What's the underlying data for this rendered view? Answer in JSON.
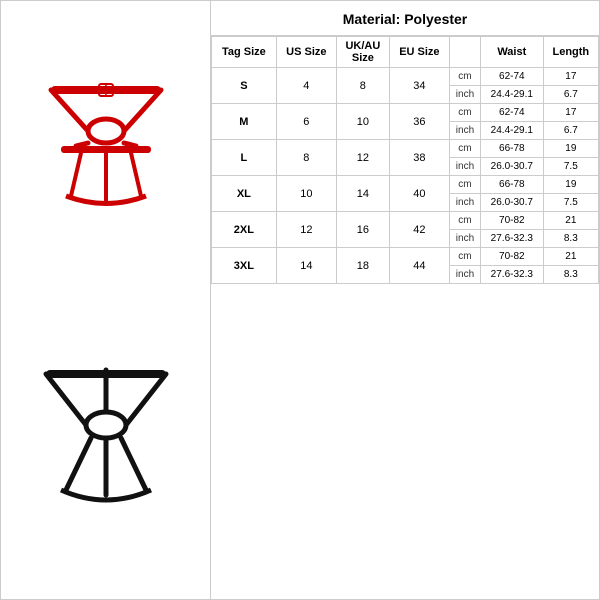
{
  "material": "Material: Polyester",
  "columns": {
    "tag_size": "Tag Size",
    "us_size": "US Size",
    "ukau_size": "UK/AU Size",
    "eu_size": "EU Size",
    "unit": "",
    "waist": "Waist",
    "length": "Length"
  },
  "rows": [
    {
      "tag": "S",
      "us": "4",
      "ukau": "8",
      "eu": "34",
      "cm": {
        "waist": "62-74",
        "length": "17"
      },
      "inch": {
        "waist": "24.4-29.1",
        "length": "6.7"
      }
    },
    {
      "tag": "M",
      "us": "6",
      "ukau": "10",
      "eu": "36",
      "cm": {
        "waist": "62-74",
        "length": "17"
      },
      "inch": {
        "waist": "24.4-29.1",
        "length": "6.7"
      }
    },
    {
      "tag": "L",
      "us": "8",
      "ukau": "12",
      "eu": "38",
      "cm": {
        "waist": "66-78",
        "length": "19"
      },
      "inch": {
        "waist": "26.0-30.7",
        "length": "7.5"
      }
    },
    {
      "tag": "XL",
      "us": "10",
      "ukau": "14",
      "eu": "40",
      "cm": {
        "waist": "66-78",
        "length": "19"
      },
      "inch": {
        "waist": "26.0-30.7",
        "length": "7.5"
      }
    },
    {
      "tag": "2XL",
      "us": "12",
      "ukau": "16",
      "eu": "42",
      "cm": {
        "waist": "70-82",
        "length": "21"
      },
      "inch": {
        "waist": "27.6-32.3",
        "length": "8.3"
      }
    },
    {
      "tag": "3XL",
      "us": "14",
      "ukau": "18",
      "eu": "44",
      "cm": {
        "waist": "70-82",
        "length": "21"
      },
      "inch": {
        "waist": "27.6-32.3",
        "length": "8.3"
      }
    }
  ],
  "unit_cm": "cm",
  "unit_inch": "inch"
}
